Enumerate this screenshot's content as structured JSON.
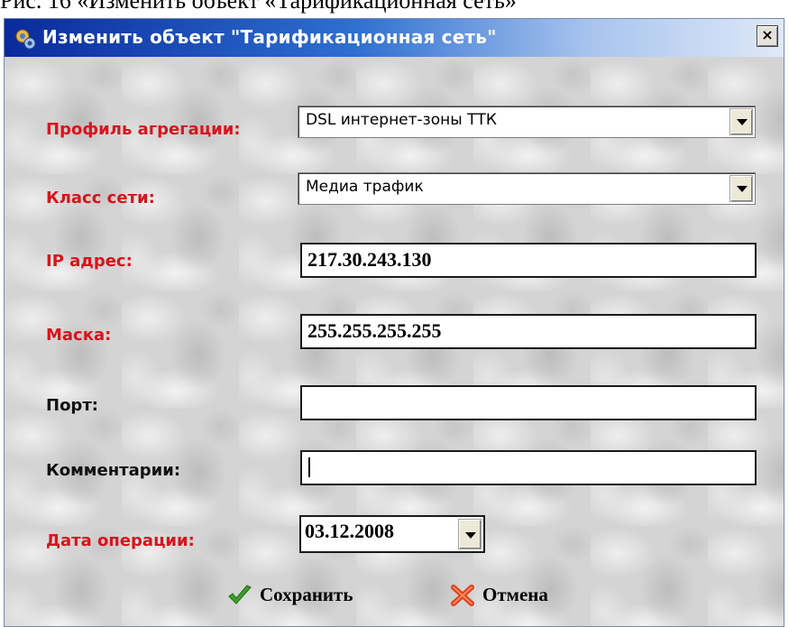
{
  "caption": "Рис. 16 «Изменить объект «Тарификационная сеть»",
  "window": {
    "title": "Изменить объект \"Тарификационная сеть\"",
    "close_label": "×"
  },
  "form": {
    "aggregation_profile": {
      "label": "Профиль агрегации:",
      "value": "DSL интернет-зоны ТТК"
    },
    "network_class": {
      "label": "Класс сети:",
      "value": "Медиа трафик"
    },
    "ip_address": {
      "label": "IP адрес:",
      "value": "217.30.243.130"
    },
    "mask": {
      "label": "Маска:",
      "value": "255.255.255.255"
    },
    "port": {
      "label": "Порт:",
      "value": ""
    },
    "comments": {
      "label": "Комментарии:",
      "value": ""
    },
    "operation_date": {
      "label": "Дата операции:",
      "value": "03.12.2008"
    }
  },
  "buttons": {
    "save_label": "Сохранить",
    "cancel_label": "Отмена"
  },
  "colors": {
    "required_label": "#d8141c",
    "title_bar_start": "#0a2a9c",
    "title_bar_end": "#dfe9f8",
    "save_icon": "#3da02a",
    "cancel_icon": "#e0401c"
  },
  "icons": {
    "title": "gears-icon",
    "save": "checkmark-icon",
    "cancel": "x-icon"
  }
}
